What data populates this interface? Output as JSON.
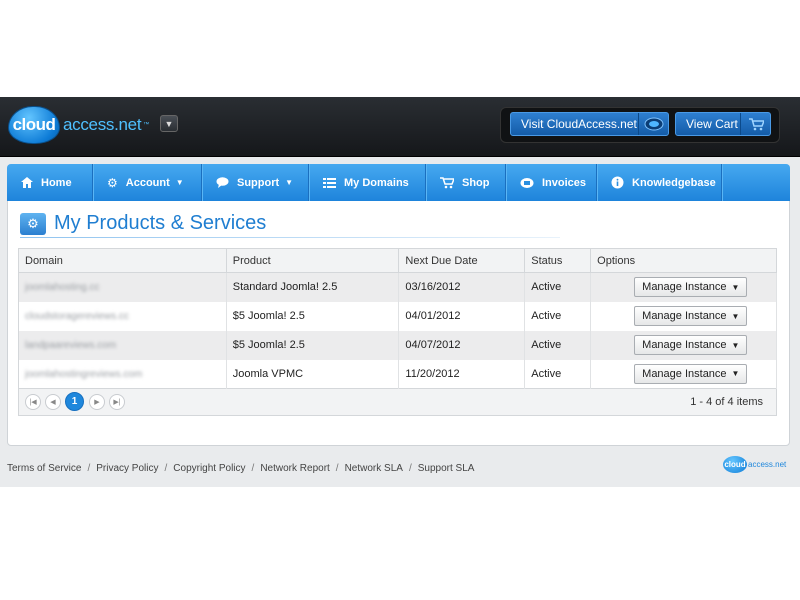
{
  "header": {
    "logo_bubble": "cloud",
    "logo_text": "access.net",
    "logo_tm": "™",
    "visit_button": "Visit CloudAccess.net",
    "cart_button": "View Cart"
  },
  "nav": {
    "items": [
      {
        "label": "Home",
        "icon": "home-icon"
      },
      {
        "label": "Account",
        "icon": "gear-icon"
      },
      {
        "label": "Support",
        "icon": "chat-icon"
      },
      {
        "label": "My Domains",
        "icon": "list-icon"
      },
      {
        "label": "Shop",
        "icon": "cart-icon"
      },
      {
        "label": "Invoices",
        "icon": "invoice-icon"
      },
      {
        "label": "Knowledgebase",
        "icon": "info-icon"
      }
    ]
  },
  "main": {
    "title": "My Products & Services",
    "table": {
      "columns": [
        "Domain",
        "Product",
        "Next Due Date",
        "Status",
        "Options"
      ],
      "rows": [
        {
          "domain": "joomlahosting.cc",
          "product": "Standard Joomla! 2.5",
          "due": "03/16/2012",
          "status": "Active",
          "option": "Manage Instance"
        },
        {
          "domain": "cloudstoragereviews.cc",
          "product": "$5 Joomla! 2.5",
          "due": "04/01/2012",
          "status": "Active",
          "option": "Manage Instance"
        },
        {
          "domain": "landpaareviews.com",
          "product": "$5 Joomla! 2.5",
          "due": "04/07/2012",
          "status": "Active",
          "option": "Manage Instance"
        },
        {
          "domain": "joomlahostingreviews.com",
          "product": "Joomla VPMC",
          "due": "11/20/2012",
          "status": "Active",
          "option": "Manage Instance"
        }
      ]
    },
    "pager": {
      "current_page": "1",
      "info": "1 - 4 of 4 items"
    }
  },
  "footer": {
    "links": [
      "Terms of Service",
      "Privacy Policy",
      "Copyright Policy",
      "Network Report",
      "Network SLA",
      "Support SLA"
    ],
    "logo_bubble": "cloud",
    "logo_text": "access.net"
  },
  "colors": {
    "accent": "#1f87dc",
    "nav_blue": "#2e93e4",
    "header_dark": "#1c1f23"
  }
}
